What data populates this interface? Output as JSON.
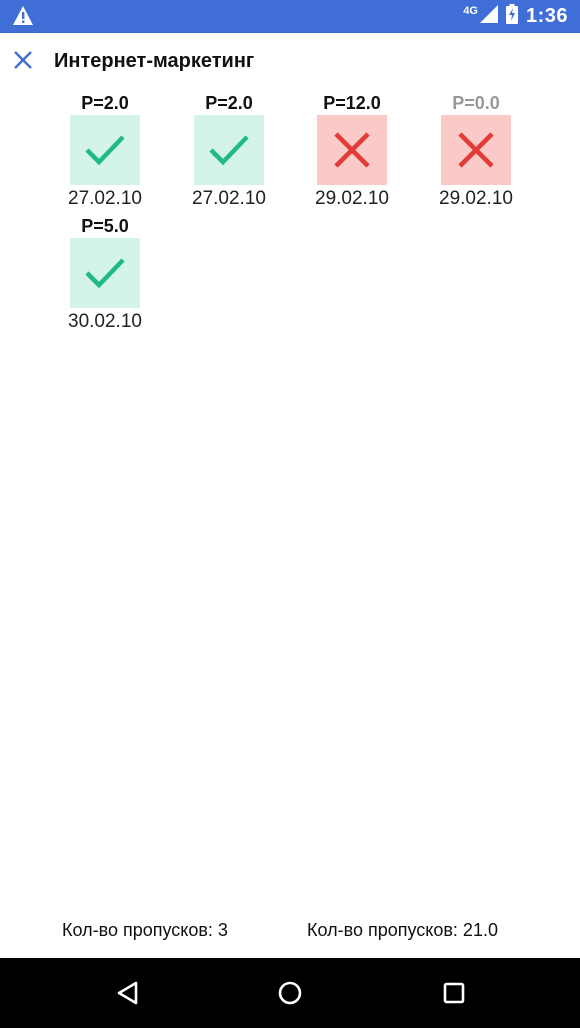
{
  "status_bar": {
    "network": "4G",
    "time": "1:36",
    "icons": [
      "warning-icon",
      "signal-icon",
      "battery-charging-icon"
    ]
  },
  "app_bar": {
    "title": "Интернет-маркетинг",
    "close_icon": "close-icon"
  },
  "records": [
    {
      "points": "P=2.0",
      "status": "ok",
      "date": "27.02.10",
      "muted": false
    },
    {
      "points": "P=2.0",
      "status": "ok",
      "date": "27.02.10",
      "muted": false
    },
    {
      "points": "P=12.0",
      "status": "bad",
      "date": "29.02.10",
      "muted": false
    },
    {
      "points": "P=0.0",
      "status": "bad",
      "date": "29.02.10",
      "muted": true
    },
    {
      "points": "P=5.0",
      "status": "ok",
      "date": "30.02.10",
      "muted": false
    }
  ],
  "footer": {
    "left": "Кол-во пропусков: 3",
    "right": "Кол-во пропусков: 21.0"
  },
  "nav_bar": {
    "icons": [
      "back-icon",
      "home-icon",
      "recents-icon"
    ]
  },
  "colors": {
    "status_bar": "#3f6fd6",
    "check_green": "#1fb98a",
    "check_bg": "#d4f4e8",
    "cross_red": "#e23a36",
    "cross_bg": "#fac9c8"
  }
}
